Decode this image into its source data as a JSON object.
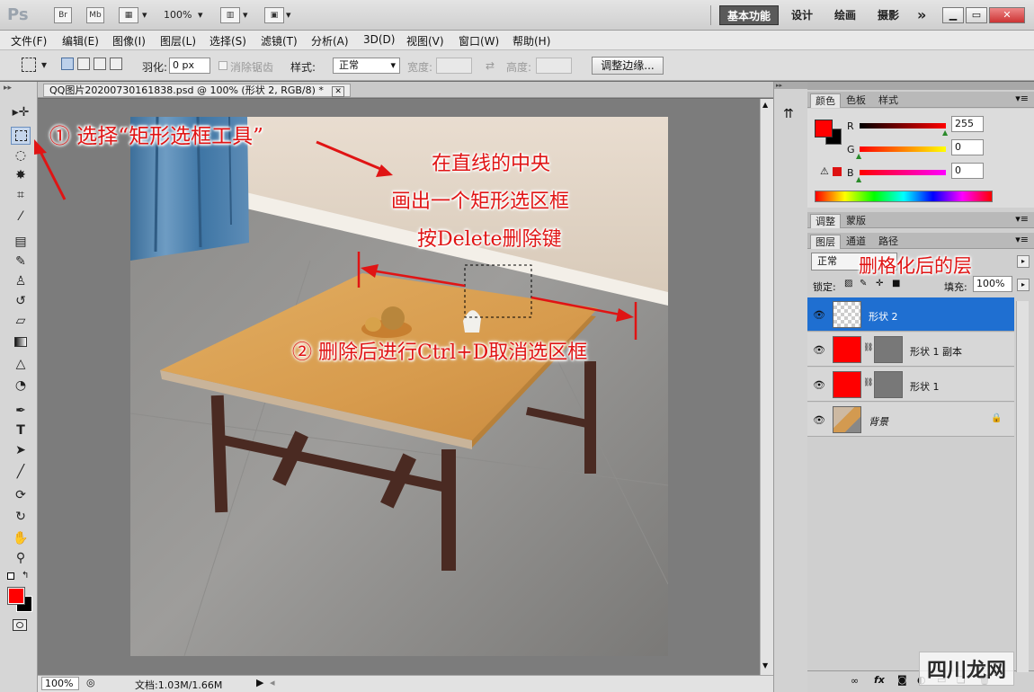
{
  "app": {
    "logo": "Ps",
    "br": "Br",
    "mb": "Mb",
    "zoom": "100%",
    "workspaces": [
      "基本功能",
      "设计",
      "绘画",
      "摄影"
    ],
    "more": "»"
  },
  "menu": [
    "文件(F)",
    "编辑(E)",
    "图像(I)",
    "图层(L)",
    "选择(S)",
    "滤镜(T)",
    "分析(A)",
    "3D(D)",
    "视图(V)",
    "窗口(W)",
    "帮助(H)"
  ],
  "options": {
    "feather_label": "羽化:",
    "feather_value": "0 px",
    "antialias_label": "消除锯齿",
    "style_label": "样式:",
    "style_value": "正常",
    "width_label": "宽度:",
    "height_label": "高度:",
    "refine_button": "调整边缘..."
  },
  "document": {
    "tab_title": "QQ图片20200730161838.psd @ 100% (形状 2, RGB/8) *",
    "status_zoom": "100%",
    "status_doc": "文档:1.03M/1.66M"
  },
  "annotations": {
    "step1": "① 选择“矩形选框工具”",
    "center1": "在直线的中央",
    "center2": "画出一个矩形选区框",
    "center3": "按Delete删除键",
    "step2": "② 删除后进行Ctrl+D取消选区框",
    "layer_note": "删格化后的层"
  },
  "color_panel": {
    "tabs": [
      "颜色",
      "色板",
      "样式"
    ],
    "r_label": "R",
    "g_label": "G",
    "b_label": "B",
    "r": "255",
    "g": "0",
    "b": "0",
    "r_level": 1.0,
    "g_level": 0.0,
    "b_level": 0.0,
    "foreground": "#ff0000",
    "background": "#000000"
  },
  "adjust_panel": {
    "tabs": [
      "调整",
      "蒙版"
    ]
  },
  "layers_panel": {
    "tabs": [
      "图层",
      "通道",
      "路径"
    ],
    "blend_mode": "正常",
    "lock_label": "锁定:",
    "fill_label": "填充:",
    "fill_value": "100%",
    "layers": [
      {
        "name": "形状 2",
        "selected": true
      },
      {
        "name": "形状 1 副本",
        "selected": false
      },
      {
        "name": "形状 1",
        "selected": false
      },
      {
        "name": "背景",
        "selected": false
      }
    ]
  },
  "watermark": "四川龙网"
}
